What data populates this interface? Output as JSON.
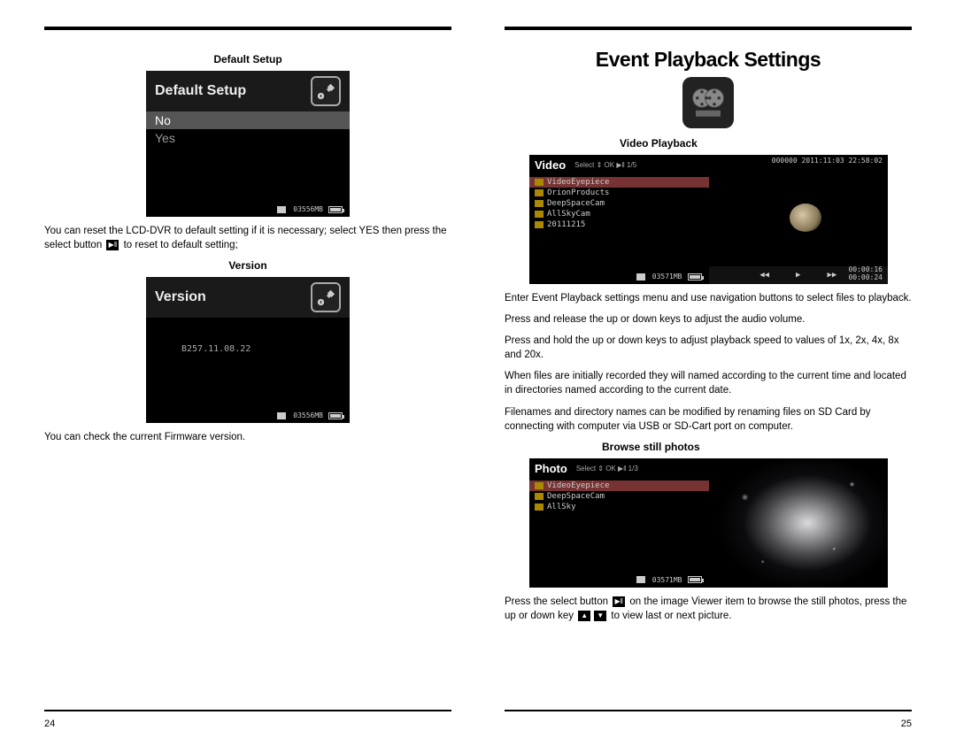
{
  "leftPage": {
    "number": "24",
    "defaultSetup": {
      "heading": "Default Setup",
      "screen": {
        "title": "Default Setup",
        "optNo": "No",
        "optYes": "Yes",
        "storage": "03556MB"
      },
      "caption_a": "You can reset the LCD-DVR to default setting if it is necessary; select YES then press the select button ",
      "caption_b": " to reset to default setting;"
    },
    "version": {
      "heading": "Version",
      "screen": {
        "title": "Version",
        "fw": "B257.11.08.22",
        "storage": "03556MB"
      },
      "caption": "You can check the current Firmware version."
    }
  },
  "rightPage": {
    "number": "25",
    "title": "Event Playback Settings",
    "videoPlayback": {
      "heading": "Video Playback",
      "leftScreen": {
        "title": "Video",
        "sub": "Select ⇕ OK ▶‖ 1/5",
        "items": [
          "VideoEyepiece",
          "OrionProducts",
          "DeepSpaceCam",
          "AllSkyCam",
          "20111215"
        ],
        "storage": "03571MB"
      },
      "rightScreen": {
        "topinfo": "000000 2011:11:03 22:58:02",
        "t_elapsed": "00:00:16",
        "t_total": "00:00:24"
      },
      "p1": "Enter Event Playback settings menu and use navigation buttons to select files to playback.",
      "p2": "Press and release the up or down keys to adjust the audio volume.",
      "p3": "Press and hold the up or down keys to adjust playback speed to values of 1x, 2x, 4x, 8x and 20x.",
      "p4": "When files are initially recorded they will named according to the current time and located in directories named according to the current date.",
      "p5": "Filenames and directory names can be modified by renaming files on SD Card by connecting with computer via USB or SD-Cart port on computer."
    },
    "browsePhotos": {
      "heading": "Browse still photos",
      "leftScreen": {
        "title": "Photo",
        "sub": "Select ⇕ OK ▶‖ 1/3",
        "items": [
          "VideoEyepiece",
          "DeepSpaceCam",
          "AllSky"
        ],
        "storage": "03571MB"
      },
      "caption_a": "Press the select button ",
      "caption_b": " on the image Viewer item to browse the still photos, press the up or down key ",
      "caption_c": " to view last or next picture."
    }
  }
}
